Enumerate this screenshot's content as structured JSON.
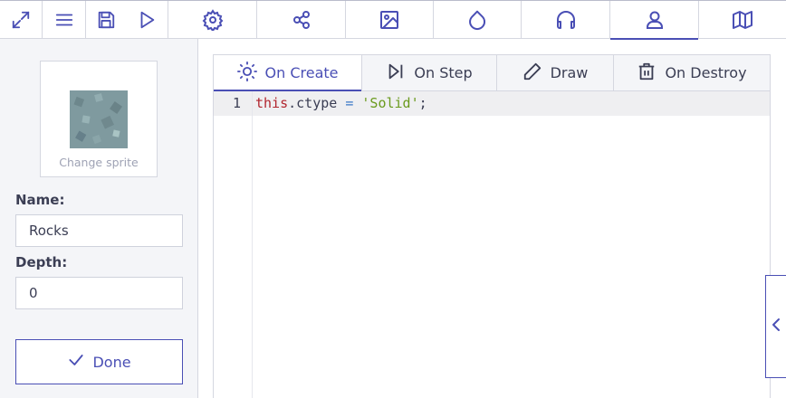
{
  "toolbar": {
    "buttons": [
      {
        "icon": "expand-icon"
      },
      {
        "icon": "menu-icon"
      },
      {
        "icon": "save-icon"
      },
      {
        "icon": "play-icon"
      },
      {
        "icon": "gear-icon"
      },
      {
        "icon": "share-nodes-icon"
      },
      {
        "icon": "image-icon"
      },
      {
        "icon": "droplet-icon"
      },
      {
        "icon": "headphones-icon"
      },
      {
        "icon": "user-icon",
        "active": true
      },
      {
        "icon": "map-icon"
      }
    ]
  },
  "sprite": {
    "caption": "Change sprite"
  },
  "fields": {
    "name_label": "Name:",
    "name_value": "Rocks",
    "depth_label": "Depth:",
    "depth_value": "0"
  },
  "done_label": "Done",
  "tabs": [
    {
      "label": "On Create",
      "icon": "sun-icon",
      "active": true
    },
    {
      "label": "On Step",
      "icon": "step-forward-icon"
    },
    {
      "label": "Draw",
      "icon": "pencil-icon"
    },
    {
      "label": "On Destroy",
      "icon": "trash-icon"
    }
  ],
  "editor": {
    "line_number": "1",
    "code": {
      "keyword": "this",
      "member": ".ctype ",
      "operator": "=",
      "space": " ",
      "string": "'Solid'",
      "end": ";"
    }
  },
  "colors": {
    "accent": "#4a4fb5",
    "panel_bg": "#f4f5f8",
    "border": "#d5d7e0",
    "keyword": "#b2262f",
    "string": "#6a9a1d"
  }
}
